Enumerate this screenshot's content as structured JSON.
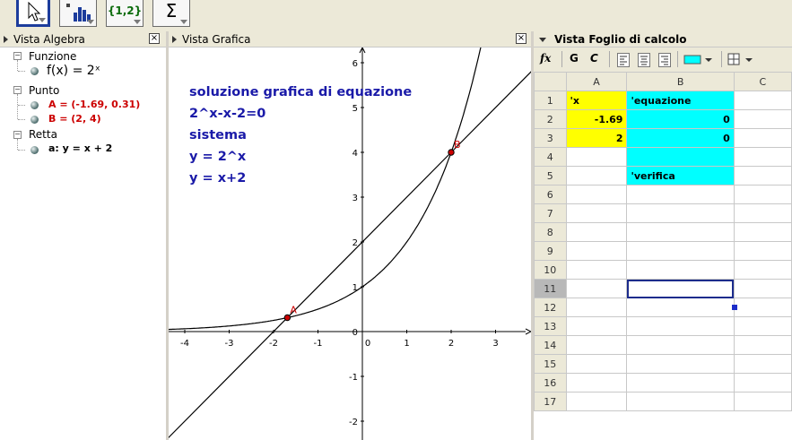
{
  "toolbar": {
    "set_label": "{1,2}",
    "sum_label": "Σ"
  },
  "algebra": {
    "title": "Vista Algebra",
    "groups": [
      {
        "label": "Funzione",
        "items": [
          {
            "text": "f(x) = 2ˣ",
            "color": "#000000"
          }
        ]
      },
      {
        "label": "Punto",
        "items": [
          {
            "text": "A = (-1.69, 0.31)",
            "color": "#cc0000"
          },
          {
            "text": "B = (2, 4)",
            "color": "#cc0000"
          }
        ]
      },
      {
        "label": "Retta",
        "items": [
          {
            "text": "a: y = x + 2",
            "color": "#000000"
          }
        ]
      }
    ]
  },
  "graphics": {
    "title": "Vista Grafica",
    "text_lines": [
      "soluzione grafica di equazione",
      "2^x-x-2=0",
      "sistema",
      "y = 2^x",
      "y = x+2"
    ],
    "text_color": "#1a1aa8",
    "point_A_label": "A",
    "point_B_label": "B",
    "x_ticks": [
      "-4",
      "-3",
      "-2",
      "-1",
      "0",
      "1",
      "2",
      "3"
    ],
    "y_ticks": [
      "6",
      "5",
      "4",
      "3",
      "2",
      "1",
      "0",
      "-1",
      "-2"
    ],
    "point_color": "#cc0000"
  },
  "sheet": {
    "title": "Vista Foglio di calcolo",
    "toolbar": {
      "fx": "fx",
      "bold": "G",
      "italic": "C"
    },
    "columns": [
      "A",
      "B",
      "C"
    ],
    "rows": [
      {
        "n": "1",
        "a": "'x",
        "b": "'equazione"
      },
      {
        "n": "2",
        "a": "-1.69",
        "b": "0"
      },
      {
        "n": "3",
        "a": "2",
        "b": "0"
      },
      {
        "n": "4",
        "a": "",
        "b": ""
      },
      {
        "n": "5",
        "a": "",
        "b": "'verifica"
      },
      {
        "n": "6",
        "a": "",
        "b": ""
      },
      {
        "n": "7",
        "a": "",
        "b": ""
      },
      {
        "n": "8",
        "a": "",
        "b": ""
      },
      {
        "n": "9",
        "a": "",
        "b": ""
      },
      {
        "n": "10",
        "a": "",
        "b": ""
      },
      {
        "n": "11",
        "a": "",
        "b": ""
      },
      {
        "n": "12",
        "a": "",
        "b": ""
      },
      {
        "n": "13",
        "a": "",
        "b": ""
      },
      {
        "n": "14",
        "a": "",
        "b": ""
      },
      {
        "n": "15",
        "a": "",
        "b": ""
      },
      {
        "n": "16",
        "a": "",
        "b": ""
      },
      {
        "n": "17",
        "a": "",
        "b": ""
      }
    ],
    "selected_row": "11",
    "yellow": "#ffff00",
    "cyan": "#00ffff"
  }
}
